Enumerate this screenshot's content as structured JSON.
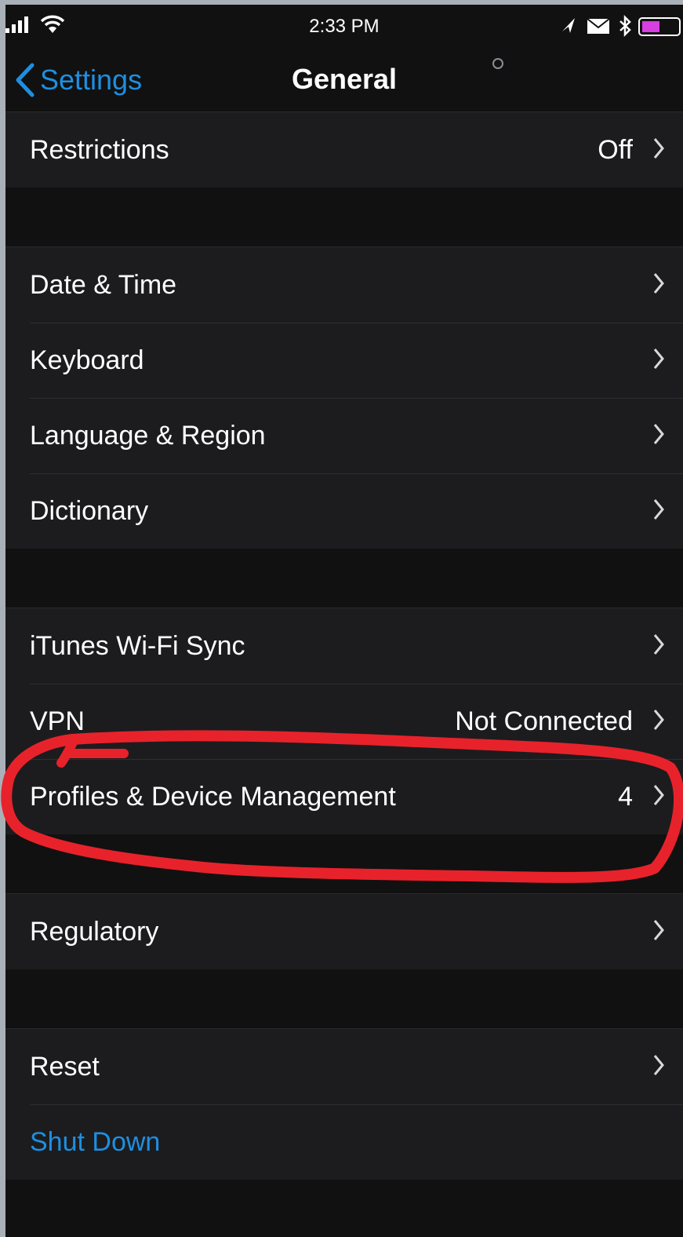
{
  "status_bar": {
    "time": "2:33 PM",
    "icons": [
      "signal-icon",
      "wifi-icon",
      "location-arrow-icon",
      "mail-icon",
      "bluetooth-icon",
      "battery-icon"
    ],
    "battery_color": "#d63fe0"
  },
  "nav": {
    "back_label": "Settings",
    "title": "General"
  },
  "sections": [
    {
      "rows": [
        {
          "label": "Restrictions",
          "value": "Off"
        }
      ]
    },
    {
      "rows": [
        {
          "label": "Date & Time",
          "value": ""
        },
        {
          "label": "Keyboard",
          "value": ""
        },
        {
          "label": "Language & Region",
          "value": ""
        },
        {
          "label": "Dictionary",
          "value": ""
        }
      ]
    },
    {
      "rows": [
        {
          "label": "iTunes Wi-Fi Sync",
          "value": ""
        },
        {
          "label": "VPN",
          "value": "Not Connected"
        },
        {
          "label": "Profiles & Device Management",
          "value": "4"
        }
      ]
    },
    {
      "rows": [
        {
          "label": "Regulatory",
          "value": ""
        }
      ]
    },
    {
      "rows": [
        {
          "label": "Reset",
          "value": ""
        },
        {
          "label": "Shut Down",
          "value": ""
        }
      ]
    }
  ],
  "colors": {
    "accent": "#1e8fe0",
    "background": "#111111",
    "cell": "#1c1c1e",
    "annotation": "#e8222b"
  }
}
